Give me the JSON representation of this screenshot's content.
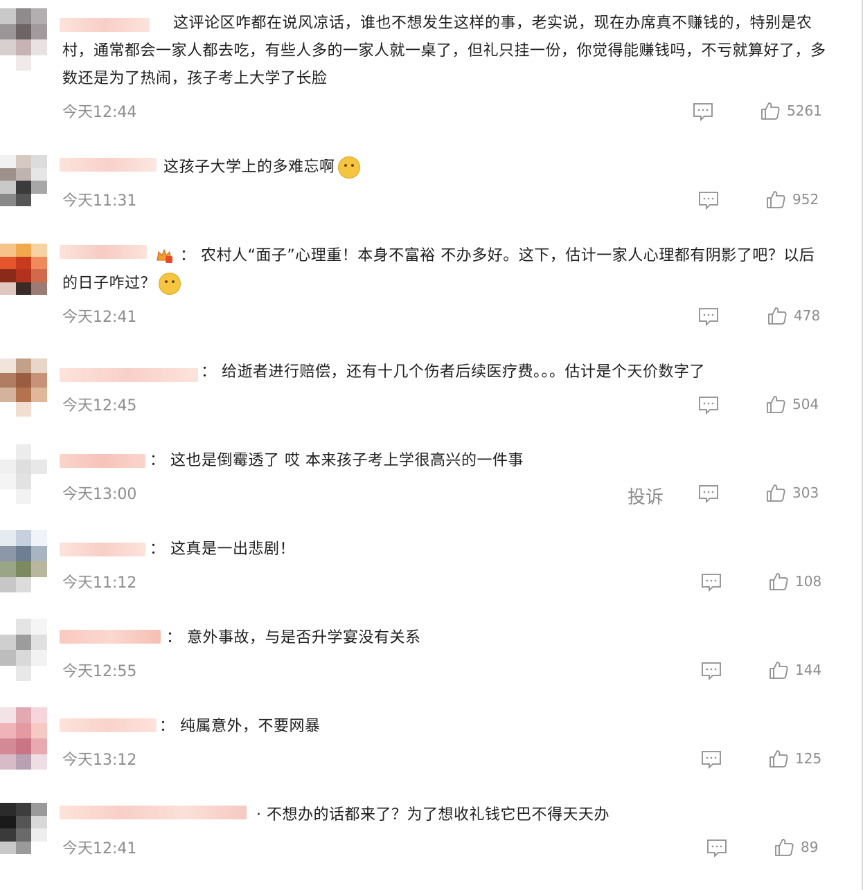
{
  "comments": [
    {
      "text": "这评论区咋都在说风凉话，谁也不想发生这样的事，老实说，现在办席真不赚钱的，特别是农村，通常都会一家人都去吃，有些人多的一家人就一桌了，但礼只挂一份，你觉得能赚钱吗，不亏就算好了，多数还是为了热闹，孩子考上大学了长脸",
      "time": "今天12:44",
      "likes": "5261"
    },
    {
      "text": "这孩子大学上的多难忘啊",
      "emoji": "laughing-crying-emoji",
      "time": "今天11:31",
      "likes": "952"
    },
    {
      "prefix": "：",
      "text": "农村人“面子”心理重！本身不富裕    不办多好。这下，估计一家人心理都有阴影了吧？以后的日子咋过？",
      "emoji": "thinking-emoji",
      "time": "今天12:41",
      "likes": "478"
    },
    {
      "prefix": "：",
      "text": "给逝者进行赔偿，还有十几个伤者后续医疗费。。。估计是个天价数字了",
      "time": "今天12:45",
      "likes": "504"
    },
    {
      "prefix": "：",
      "text": "这也是倒霉透了 哎 本来孩子考上学很高兴的一件事",
      "time": "今天13:00",
      "likes": "303",
      "report": "投诉"
    },
    {
      "prefix": "：",
      "text": "这真是一出悲剧！",
      "time": "今天11:12",
      "likes": "108"
    },
    {
      "prefix": "：",
      "text": "意外事故，与是否升学宴没有关系",
      "time": "今天12:55",
      "likes": "144"
    },
    {
      "prefix": "：",
      "text": "纯属意外，不要网暴",
      "time": "今天13:12",
      "likes": "125"
    },
    {
      "prefix": "·",
      "text": "不想办的话都来了？为了想收礼钱它巴不得天天办",
      "time": "今天12:41",
      "likes": "89"
    }
  ],
  "icons": {
    "comment": "comment-icon",
    "like": "thumbs-up-icon",
    "crown": "crown-badge-icon"
  },
  "colors": {
    "muted": "#8c8c8c",
    "text": "#1f1f1f",
    "name_blur": "#fbd9d2"
  }
}
